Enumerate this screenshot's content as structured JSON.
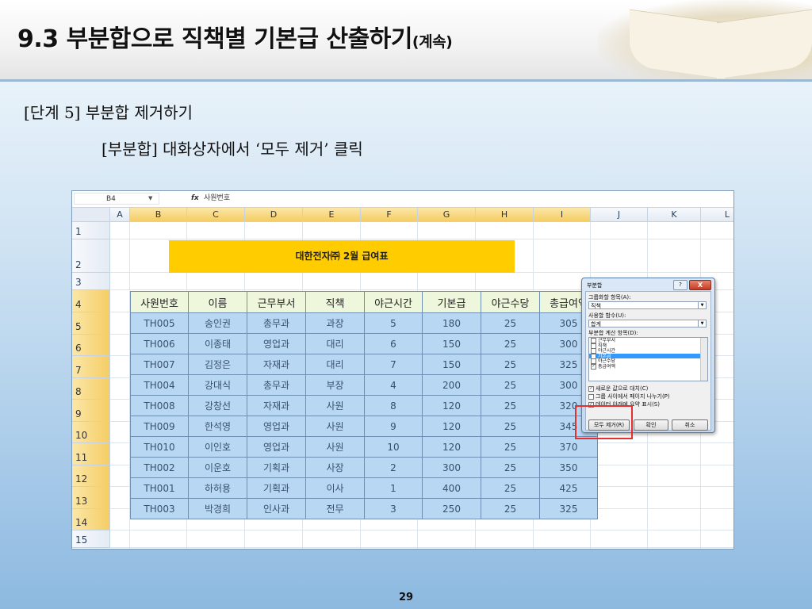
{
  "slide": {
    "title": "9.3 부분합으로 직책별 기본급 산출하기",
    "title_suffix": "(계속)",
    "step_line": "[단계 5] 부분합 제거하기",
    "instruction": "[부분합] 대화상자에서 ‘모두 제거’ 클릭",
    "page_number": "29"
  },
  "excel": {
    "name_box": "B4",
    "fx_label": "fx",
    "formula_value": "사원번호",
    "columns": [
      "A",
      "B",
      "C",
      "D",
      "E",
      "F",
      "G",
      "H",
      "I",
      "J",
      "K",
      "L"
    ],
    "rows": [
      "1",
      "2",
      "3",
      "4",
      "5",
      "6",
      "7",
      "8",
      "9",
      "10",
      "11",
      "12",
      "13",
      "14",
      "15"
    ],
    "table_title": "대한전자㈜ 2월 급여표",
    "headers": [
      "사원번호",
      "이름",
      "근무부서",
      "직책",
      "야근시간",
      "기본급",
      "야근수당",
      "총급여액"
    ],
    "records": [
      [
        "TH005",
        "송인권",
        "총무과",
        "과장",
        "5",
        "180",
        "25",
        "305"
      ],
      [
        "TH006",
        "이종태",
        "영업과",
        "대리",
        "6",
        "150",
        "25",
        "300"
      ],
      [
        "TH007",
        "김정은",
        "자재과",
        "대리",
        "7",
        "150",
        "25",
        "325"
      ],
      [
        "TH004",
        "강대식",
        "총무과",
        "부장",
        "4",
        "200",
        "25",
        "300"
      ],
      [
        "TH008",
        "강창선",
        "자재과",
        "사원",
        "8",
        "120",
        "25",
        "320"
      ],
      [
        "TH009",
        "한석영",
        "영업과",
        "사원",
        "9",
        "120",
        "25",
        "345"
      ],
      [
        "TH010",
        "이인호",
        "영업과",
        "사원",
        "10",
        "120",
        "25",
        "370"
      ],
      [
        "TH002",
        "이운호",
        "기획과",
        "사장",
        "2",
        "300",
        "25",
        "350"
      ],
      [
        "TH001",
        "하허용",
        "기획과",
        "이사",
        "1",
        "400",
        "25",
        "425"
      ],
      [
        "TH003",
        "박경희",
        "인사과",
        "전무",
        "3",
        "250",
        "25",
        "325"
      ]
    ]
  },
  "dialog": {
    "title": "부분합",
    "help": "?",
    "close": "X",
    "group_label": "그룹화할 항목(A):",
    "group_value": "직책",
    "func_label": "사용할 함수(U):",
    "func_value": "합계",
    "calc_label": "부분합 계산 항목(D):",
    "calc_items": [
      {
        "label": "근무부서",
        "checked": false
      },
      {
        "label": "직책",
        "checked": false
      },
      {
        "label": "야근시간",
        "checked": false
      },
      {
        "label": "기본급",
        "checked": true
      },
      {
        "label": "야근수당",
        "checked": false
      },
      {
        "label": "총급여액",
        "checked": true
      }
    ],
    "opt_replace": "새로운 값으로 대치(C)",
    "opt_pagebreak": "그룹 사이에서 페이지 나누기(P)",
    "opt_summary": "데이터 아래에 요약 표시(S)",
    "btn_remove": "모두 제거(R)",
    "btn_ok": "확인",
    "btn_cancel": "취소"
  }
}
